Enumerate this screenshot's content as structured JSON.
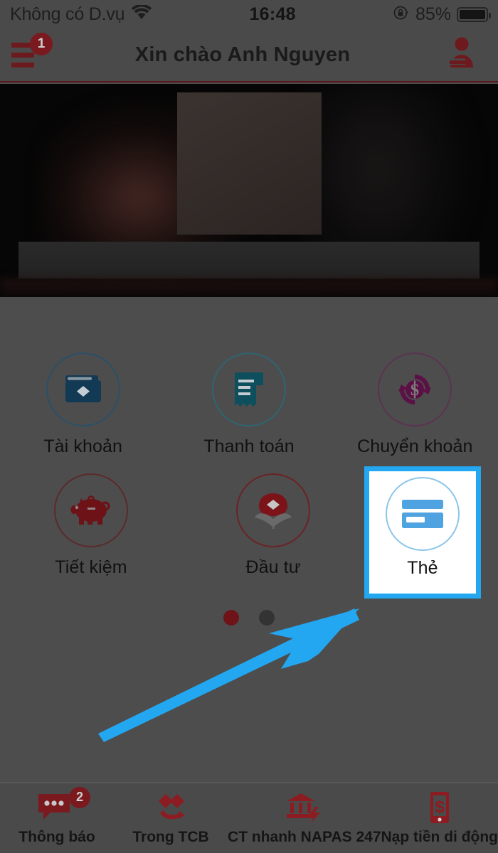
{
  "status_bar": {
    "carrier": "Không có D.vụ",
    "wifi_icon": "wifi-icon",
    "time": "16:48",
    "rotation_lock_icon": "rotation-lock-icon",
    "battery_percent": "85%",
    "battery_icon": "battery-icon"
  },
  "header": {
    "menu_icon": "hamburger-menu-icon",
    "menu_badge": "1",
    "title": "Xin chào Anh Nguyen",
    "logout_icon": "user-logout-icon"
  },
  "banner": {
    "type": "promotional-banner-image"
  },
  "services": {
    "row1": [
      {
        "label": "Tài khoản",
        "icon": "wallet-icon",
        "color": "#123a55"
      },
      {
        "label": "Thanh toán",
        "icon": "invoice-icon",
        "color": "#0e4f5e"
      },
      {
        "label": "Chuyển khoản",
        "icon": "transfer-money-icon",
        "color": "#5c1046"
      }
    ],
    "row2": [
      {
        "label": "Tiết kiệm",
        "icon": "piggy-bank-icon",
        "color": "#6d1216"
      },
      {
        "label": "Đầu tư",
        "icon": "investment-plant-icon",
        "color": "#7c1318"
      },
      {
        "label": "Thẻ",
        "icon": "credit-card-icon",
        "color": "#4fa3e0"
      }
    ]
  },
  "highlight": {
    "target_label": "Thẻ",
    "border_color": "#22a7f0",
    "arrow_color": "#22a7f0"
  },
  "pagination": {
    "dots": 2,
    "active_index": 0,
    "active_color": "#6e1318",
    "inactive_color": "#333333"
  },
  "bottom_nav": [
    {
      "label": "Thông báo",
      "icon": "chat-notification-icon",
      "badge": "2"
    },
    {
      "label": "Trong TCB",
      "icon": "techcombank-transfer-icon",
      "badge": ""
    },
    {
      "label": "CT nhanh NAPAS 247",
      "icon": "bank-fast-transfer-icon",
      "badge": ""
    },
    {
      "label": "Nạp tiền di động",
      "icon": "mobile-topup-icon",
      "badge": ""
    }
  ]
}
